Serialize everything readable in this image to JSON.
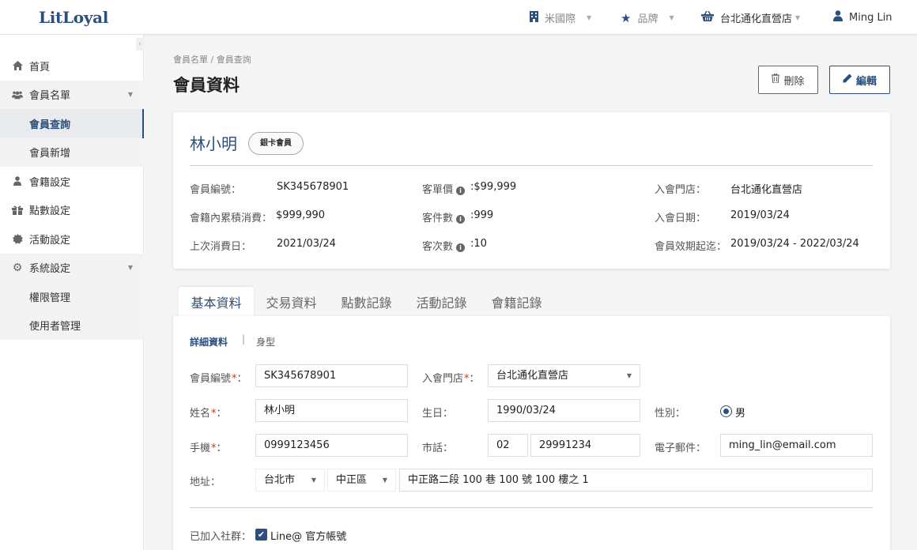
{
  "app": {
    "logo": "LitLoyal"
  },
  "topnav": {
    "company": "米國際",
    "brand": "品牌",
    "store": "台北通化直營店",
    "user": "Ming Lin"
  },
  "sidebar": {
    "items": [
      {
        "label": "首頁"
      },
      {
        "label": "會員名單"
      },
      {
        "label": "會員查詢"
      },
      {
        "label": "會員新增"
      },
      {
        "label": "會籍設定"
      },
      {
        "label": "點數設定"
      },
      {
        "label": "活動設定"
      },
      {
        "label": "系統設定"
      },
      {
        "label": "權限管理"
      },
      {
        "label": "使用者管理"
      }
    ]
  },
  "header": {
    "breadcrumb": "會員名單 / 會員查詢",
    "title": "會員資料",
    "delete_label": "刪除",
    "edit_label": "編輯"
  },
  "summary": {
    "name": "林小明",
    "tier": "銀卡會員",
    "fields": {
      "member_no_label": "會員編號：",
      "member_no": "SK345678901",
      "avg_price_label": "客單價",
      "avg_price": ":$99,999",
      "join_store_label": "入會門店：",
      "join_store": "台北通化直營店",
      "total_spend_label": "會籍內累積消費：",
      "total_spend": "$999,990",
      "items_label": "客件數",
      "items": ":999",
      "join_date_label": "入會日期：",
      "join_date": "2019/03/24",
      "last_spend_label": "上次消費日：",
      "last_spend": "2021/03/24",
      "visits_label": "客次數",
      "visits": ":10",
      "validity_label": "會員效期起迄：",
      "validity": "2019/03/24 - 2022/03/24"
    }
  },
  "tabs": [
    "基本資料",
    "交易資料",
    "點數記錄",
    "活動記錄",
    "會籍記錄"
  ],
  "detail": {
    "subtab_active": "詳細資料",
    "subtab_separator": "|",
    "subtab_other": "身型",
    "member_no_label": "會員編號",
    "member_no": "SK345678901",
    "store_label": "入會門店",
    "store": "台北通化直營店",
    "name_label": "姓名",
    "name": "林小明",
    "birthday_label": "生日：",
    "birthday": "1990/03/24",
    "gender_label": "性別：",
    "gender": "男",
    "mobile_label": "手機",
    "mobile": "0999123456",
    "phone_label": "市話：",
    "phone_area": "02",
    "phone": "29991234",
    "email_label": "電子郵件：",
    "email": "ming_lin@email.com",
    "address_label": "地址：",
    "city": "台北市",
    "district": "中正區",
    "address": "中正路二段 100 巷 100 號 100 樓之 1",
    "social_label": "已加入社群：",
    "social": "Line@ 官方帳號"
  },
  "required_mark": "*",
  "colon": "：",
  "colors": {
    "primary": "#2b4f7e",
    "required": "#c0392b"
  }
}
